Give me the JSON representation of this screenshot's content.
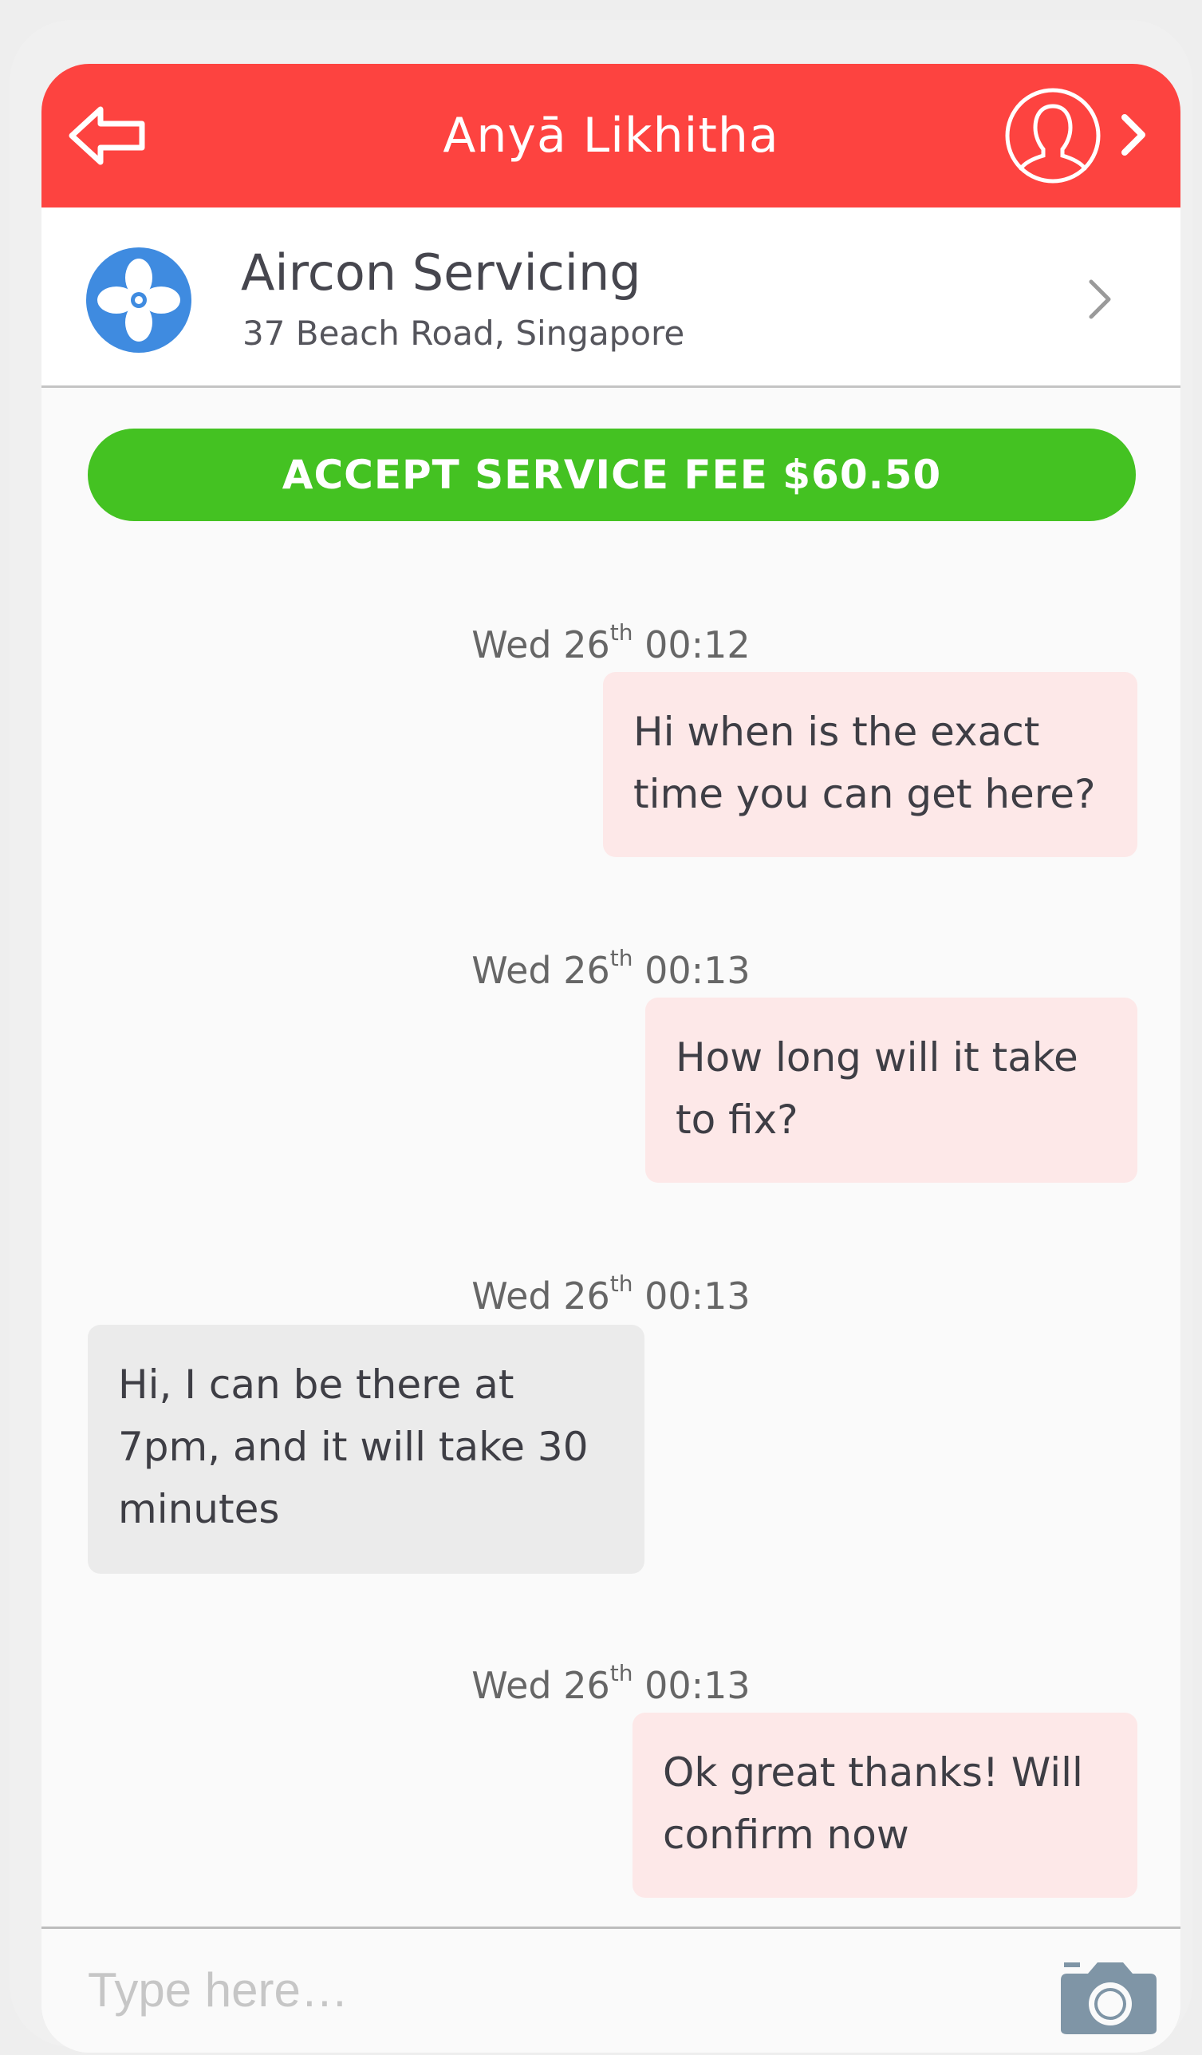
{
  "colors": {
    "header_bg": "#fd4340",
    "accept_bg": "#44c222",
    "outgoing_bubble": "#fde8e8",
    "incoming_bubble": "#ebebeb",
    "job_icon": "#3f8be0",
    "camera_icon": "#7f95a6"
  },
  "header": {
    "title": "Anyā Likhitha",
    "back_icon": "back-arrow-icon",
    "profile_icon": "user-profile-icon",
    "chevron_icon": "chevron-right-icon"
  },
  "job": {
    "icon": "fan-icon",
    "title": "Aircon Servicing",
    "address": "37 Beach Road, Singapore",
    "chevron_icon": "chevron-right-icon"
  },
  "accept_button": {
    "label": "ACCEPT SERVICE FEE $60.50"
  },
  "messages": [
    {
      "timestamp": {
        "day": "Wed 26",
        "suffix": "th",
        "time": "00:12"
      },
      "direction": "outgoing",
      "lines": [
        "Hi when is the exact",
        "time you can get here?"
      ]
    },
    {
      "timestamp": {
        "day": "Wed 26",
        "suffix": "th",
        "time": "00:13"
      },
      "direction": "outgoing",
      "lines": [
        "How long will it take",
        "to fix?"
      ]
    },
    {
      "timestamp": {
        "day": "Wed 26",
        "suffix": "th",
        "time": "00:13"
      },
      "direction": "incoming",
      "lines": [
        "Hi, I can be there at",
        "7pm, and it will take 30",
        "minutes"
      ]
    },
    {
      "timestamp": {
        "day": "Wed 26",
        "suffix": "th",
        "time": "00:13"
      },
      "direction": "outgoing",
      "lines": [
        "Ok great thanks! Will",
        "confirm now"
      ]
    }
  ],
  "composer": {
    "placeholder": "Type here…",
    "value": "",
    "camera_icon": "camera-icon"
  }
}
